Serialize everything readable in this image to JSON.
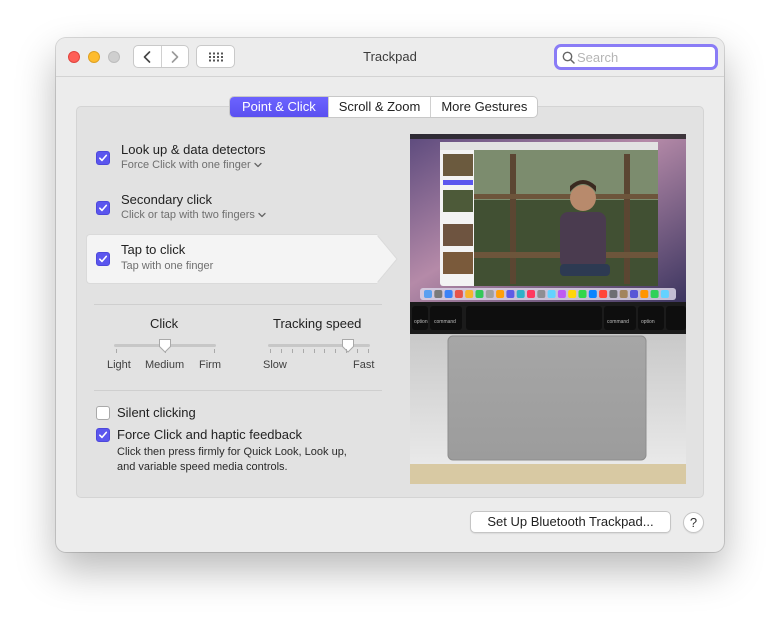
{
  "window": {
    "title": "Trackpad"
  },
  "search": {
    "placeholder": "Search"
  },
  "tabs": [
    {
      "label": "Point & Click",
      "active": true
    },
    {
      "label": "Scroll & Zoom",
      "active": false
    },
    {
      "label": "More Gestures",
      "active": false
    }
  ],
  "options": [
    {
      "label": "Look up & data detectors",
      "sublabel": "Force Click with one finger",
      "checked": true,
      "has_dropdown": true
    },
    {
      "label": "Secondary click",
      "sublabel": "Click or tap with two fingers",
      "checked": true,
      "has_dropdown": true
    },
    {
      "label": "Tap to click",
      "sublabel": "Tap with one finger",
      "checked": true,
      "selected": true,
      "has_dropdown": false
    }
  ],
  "click_slider": {
    "label": "Click",
    "ticks": [
      "Light",
      "Medium",
      "Firm"
    ],
    "value": "Medium"
  },
  "tracking_slider": {
    "label": "Tracking speed",
    "min_label": "Slow",
    "max_label": "Fast",
    "level": 0.8
  },
  "silent_clicking": {
    "label": "Silent clicking",
    "checked": false
  },
  "force_click": {
    "label": "Force Click and haptic feedback",
    "checked": true,
    "description_line1": "Click then press firmly for Quick Look, Look up,",
    "description_line2": "and variable speed media controls."
  },
  "preview": {
    "keys": {
      "left_modifier": "option",
      "left_command": "command",
      "right_command": "command",
      "right_option": "option"
    }
  },
  "footer": {
    "bluetooth_button": "Set Up Bluetooth Trackpad...",
    "help_label": "?"
  },
  "colors": {
    "accent": "#5b56ee",
    "search_focus": "#8a7cf6"
  }
}
